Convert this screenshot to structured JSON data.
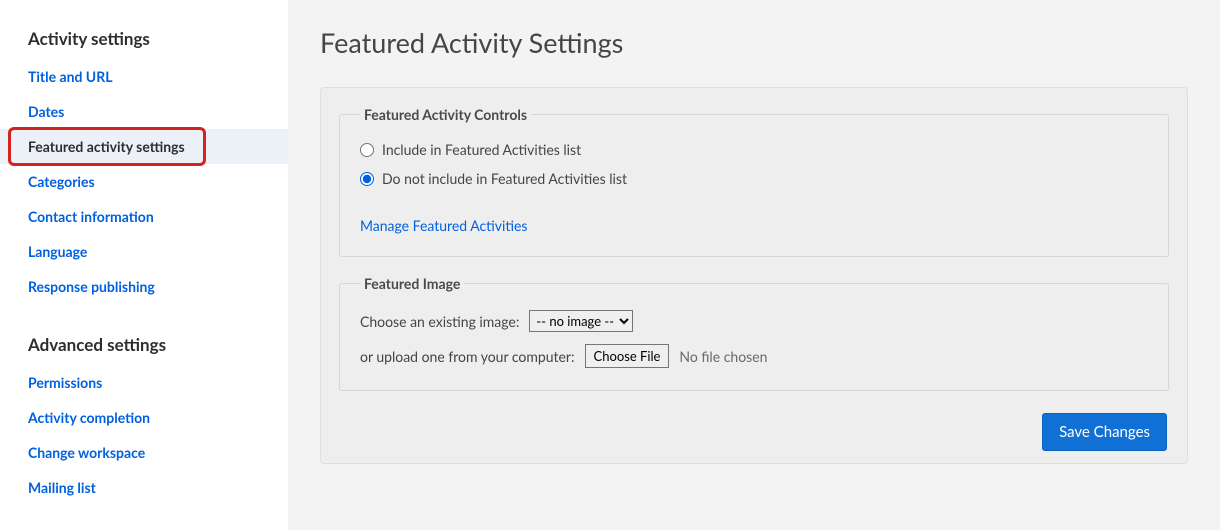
{
  "sidebar": {
    "heading1": "Activity settings",
    "heading2": "Advanced settings",
    "activity_items": [
      {
        "label": "Title and URL"
      },
      {
        "label": "Dates"
      },
      {
        "label": "Featured activity settings"
      },
      {
        "label": "Categories"
      },
      {
        "label": "Contact information"
      },
      {
        "label": "Language"
      },
      {
        "label": "Response publishing"
      }
    ],
    "advanced_items": [
      {
        "label": "Permissions"
      },
      {
        "label": "Activity completion"
      },
      {
        "label": "Change workspace"
      },
      {
        "label": "Mailing list"
      }
    ]
  },
  "main": {
    "title": "Featured Activity Settings",
    "controls": {
      "legend": "Featured Activity Controls",
      "opt_include": "Include in Featured Activities list",
      "opt_exclude": "Do not include in Featured Activities list",
      "manage_link": "Manage Featured Activities"
    },
    "image": {
      "legend": "Featured Image",
      "choose_label": "Choose an existing image:",
      "no_image_opt": "-- no image --",
      "or_upload_label": "or upload one from your computer:",
      "choose_file_btn": "Choose File",
      "no_file_text": "No file chosen"
    },
    "save_label": "Save Changes"
  }
}
